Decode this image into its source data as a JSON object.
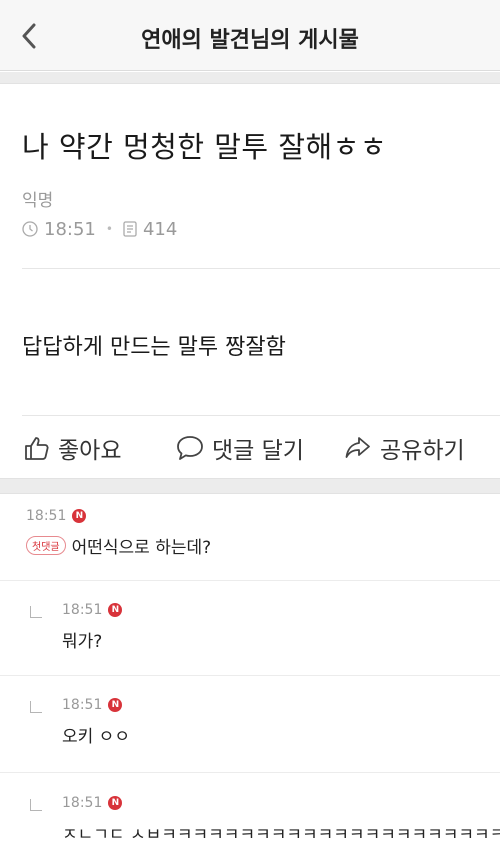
{
  "header": {
    "title": "연애의 발견님의 게시물"
  },
  "post": {
    "title": "나 약간 멍청한 말투 잘해ㅎㅎ",
    "author": "익명",
    "time": "18:51",
    "views": "414",
    "body": "답답하게 만드는 말투 짱잘함"
  },
  "actions": {
    "like": "좋아요",
    "comment": "댓글 달기",
    "share": "공유하기"
  },
  "comments": [
    {
      "time": "18:51",
      "badge": "N",
      "first_badge": "첫댓글",
      "text": "어떤식으로 하는데?"
    },
    {
      "time": "18:51",
      "badge": "N",
      "text": "뭐가?"
    },
    {
      "time": "18:51",
      "badge": "N",
      "text": "오키 ㅇㅇ"
    },
    {
      "time": "18:51",
      "badge": "N",
      "text": "ㅈㄴㄱㄷ ㅅㅂㅋㅋㅋㅋㅋㅋㅋㅋㅋㅋㅋㅋㅋㅋㅋㅋㅋㅋㅋㅋㅋㅋㅋ"
    }
  ]
}
